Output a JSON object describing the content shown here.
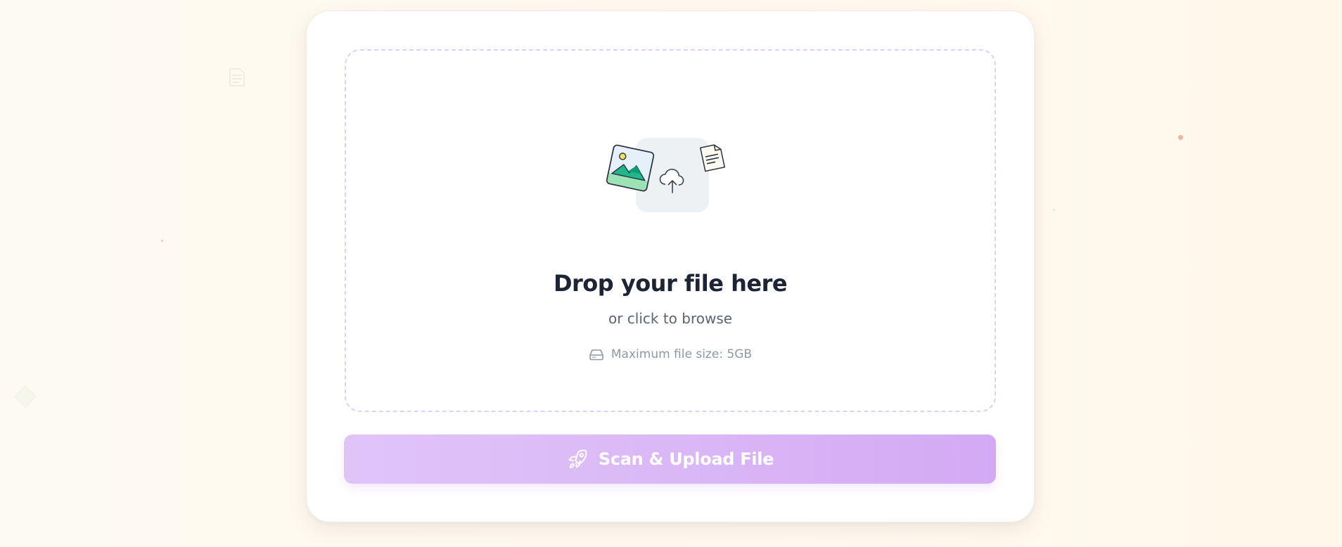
{
  "upload_card": {
    "dropzone": {
      "title": "Drop your file here",
      "subtitle": "or click to browse",
      "max_size_label": "Maximum file size: 5GB",
      "illustration_icons": [
        "image-icon",
        "cloud-upload-icon",
        "document-icon"
      ],
      "size_icon": "hard-drive-icon"
    },
    "upload_button": {
      "label": "Scan & Upload File",
      "icon": "rocket-icon"
    }
  },
  "colors": {
    "accent": "#d9b6f6",
    "dropzone_border": "#ddd0f4",
    "title": "#1c2436",
    "subtitle": "#5a6474",
    "muted": "#8e97a4",
    "background": "#fefaf0"
  }
}
